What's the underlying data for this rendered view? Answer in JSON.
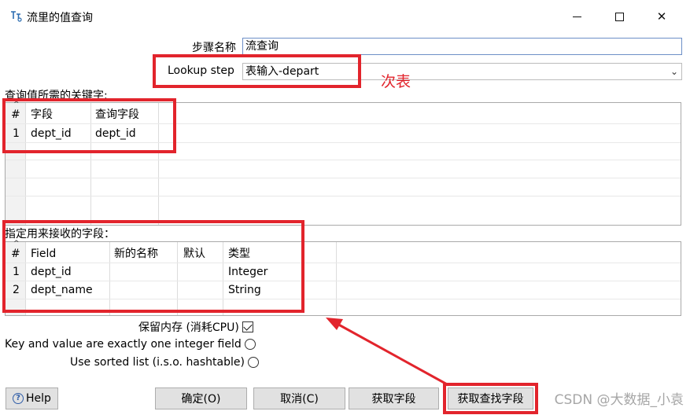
{
  "window": {
    "title": "流里的值查询"
  },
  "form": {
    "step_name_label": "步骤名称",
    "step_name_value": "流查询",
    "lookup_step_label": "Lookup step",
    "lookup_step_value": "表输入-depart"
  },
  "annotation": {
    "secondary_table": "次表"
  },
  "key_section": {
    "label": "查询值所需的关键字:",
    "columns": [
      "#",
      "字段",
      "查询字段"
    ],
    "rows": [
      [
        "1",
        "dept_id",
        "dept_id"
      ]
    ]
  },
  "receive_section": {
    "label": "指定用来接收的字段：",
    "columns": [
      "#",
      "Field",
      "新的名称",
      "默认",
      "类型"
    ],
    "rows": [
      [
        "1",
        "dept_id",
        "",
        "",
        "Integer"
      ],
      [
        "2",
        "dept_name",
        "",
        "",
        "String"
      ]
    ]
  },
  "options": {
    "preserve_memory": {
      "label": "保留内存 (消耗CPU)",
      "checked": true
    },
    "key_value_integer": {
      "label": "Key and value are exactly one integer field",
      "selected": false
    },
    "sorted_list": {
      "label": "Use sorted list (i.s.o. hashtable)",
      "selected": false
    }
  },
  "buttons": {
    "help": "Help",
    "ok": "确定(O)",
    "cancel": "取消(C)",
    "get_fields": "获取字段",
    "get_lookup_fields": "获取查找字段"
  },
  "watermark": "CSDN @大数据_小袁",
  "colors": {
    "highlight_red": "#e2242c",
    "input_border": "#6d8fc7"
  }
}
